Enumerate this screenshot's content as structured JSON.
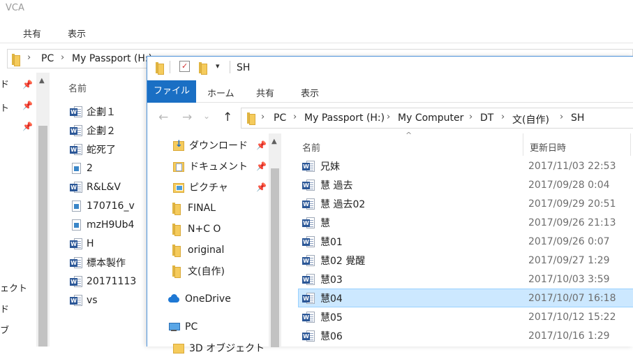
{
  "back_window": {
    "title": "VCA",
    "ribbon_tabs": [
      "共有",
      "表示"
    ],
    "breadcrumb": [
      "PC",
      "My Passport (H:)"
    ],
    "nav_fragments": [
      "ド",
      "ト",
      "ェクト",
      "ド",
      "ブ"
    ],
    "column_name": "名前",
    "files": [
      {
        "name": "企劃１",
        "icon": "word-icon"
      },
      {
        "name": "企劃２",
        "icon": "word-icon"
      },
      {
        "name": "蛇死了",
        "icon": "word-icon"
      },
      {
        "name": "2",
        "icon": "image-icon"
      },
      {
        "name": "R&L&V",
        "icon": "word-icon"
      },
      {
        "name": "170716_v",
        "icon": "image-icon"
      },
      {
        "name": "mzH9Ub4",
        "icon": "image-icon"
      },
      {
        "name": "H",
        "icon": "word-icon"
      },
      {
        "name": "標本製作",
        "icon": "word-icon"
      },
      {
        "name": "20171113",
        "icon": "word-icon"
      },
      {
        "name": "vs",
        "icon": "word-icon"
      }
    ]
  },
  "front_window": {
    "title": "SH",
    "qat_dropdown": "▾",
    "ribbon_tabs": {
      "file": "ファイル",
      "home": "ホーム",
      "share": "共有",
      "view": "表示"
    },
    "nav": {
      "back": "←",
      "forward": "→",
      "recent": "⌄",
      "up": "↑"
    },
    "breadcrumb": [
      "PC",
      "My Passport (H:)",
      "My Computer",
      "DT",
      "文(自作)",
      "SH"
    ],
    "nav_pane": [
      {
        "label": "ダウンロード",
        "icon": "download-folder-icon",
        "pinned": true
      },
      {
        "label": "ドキュメント",
        "icon": "documents-folder-icon",
        "pinned": true
      },
      {
        "label": "ピクチャ",
        "icon": "pictures-folder-icon",
        "pinned": true
      },
      {
        "label": "FINAL",
        "icon": "folder-icon",
        "pinned": false
      },
      {
        "label": "N+C O",
        "icon": "folder-icon",
        "pinned": false
      },
      {
        "label": "original",
        "icon": "folder-icon",
        "pinned": false
      },
      {
        "label": "文(自作)",
        "icon": "folder-icon",
        "pinned": false
      },
      {
        "label": "OneDrive",
        "icon": "onedrive-icon",
        "pinned": false
      },
      {
        "label": "PC",
        "icon": "pc-icon",
        "pinned": false
      },
      {
        "label": "3D オブジェクト",
        "icon": "3d-objects-icon",
        "pinned": false
      }
    ],
    "columns": {
      "name": "名前",
      "modified": "更新日時"
    },
    "files": [
      {
        "name": "兄妹",
        "modified": "2017/11/03 22:53"
      },
      {
        "name": "慧 過去",
        "modified": "2017/09/28 0:04"
      },
      {
        "name": "慧 過去02",
        "modified": "2017/09/29 20:51"
      },
      {
        "name": "慧",
        "modified": "2017/09/26 21:13"
      },
      {
        "name": "慧01",
        "modified": "2017/09/26 0:07"
      },
      {
        "name": "慧02 覺醒",
        "modified": "2017/09/27 1:29"
      },
      {
        "name": "慧03",
        "modified": "2017/10/03 3:59"
      },
      {
        "name": "慧04",
        "modified": "2017/10/07 16:18",
        "selected": true
      },
      {
        "name": "慧05",
        "modified": "2017/10/12 15:22"
      },
      {
        "name": "慧06",
        "modified": "2017/10/16 1:29"
      }
    ],
    "selection_color": "#cce8ff",
    "file_tab_color": "#1a6fc4"
  }
}
